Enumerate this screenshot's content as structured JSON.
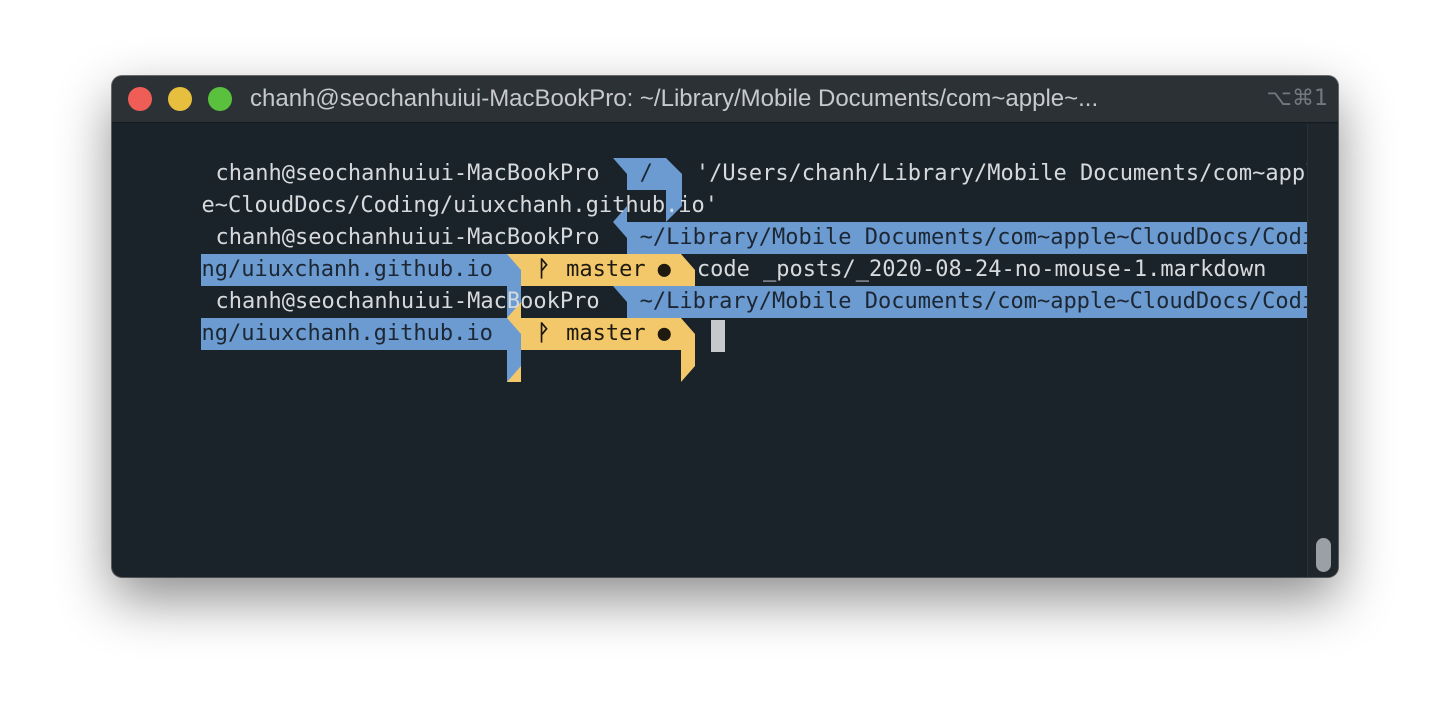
{
  "window": {
    "title": "chanh@seochanhuiui-MacBookPro: ~/Library/Mobile Documents/com~apple~...",
    "shortcut": "⌥⌘1"
  },
  "terminal": {
    "prompt_host": "chanh@seochanhuiui-MacBookPro",
    "line1": {
      "dir": "/",
      "text_part1": "'/Users/chanh/Library/Mobile Documents/com~appl",
      "text_part2": "e~CloudDocs/Coding/uiuxchanh.github.io'"
    },
    "line2": {
      "path_part1": "~/Library/Mobile Documents/com~apple~CloudDocs/Codi",
      "path_part2": "ng/uiuxchanh.github.io",
      "branch": "master",
      "dirty_mark": "●",
      "command": "code _posts/_2020-08-24-no-mouse-1.markdown"
    },
    "line3": {
      "path_part1": "~/Library/Mobile Documents/com~apple~CloudDocs/Codi",
      "path_part2": "ng/uiuxchanh.github.io",
      "branch": "master",
      "dirty_mark": "●"
    },
    "branch_glyph": "ᚹ"
  },
  "colors": {
    "background": "#1b232a",
    "path_segment": "#6b9bd1",
    "git_segment": "#f3c86b"
  }
}
